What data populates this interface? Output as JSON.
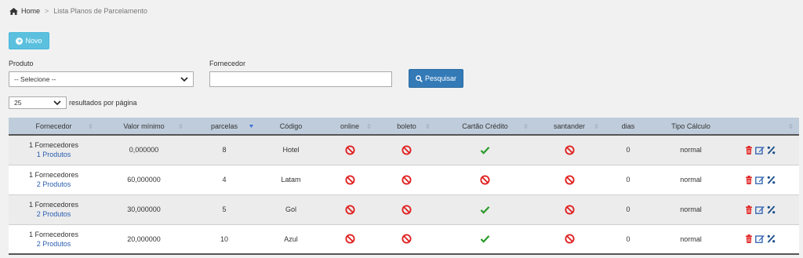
{
  "breadcrumb": {
    "home": "Home",
    "separator": ">",
    "current": "Lista Planos de Parcelamento"
  },
  "toolbar": {
    "novo_label": "Novo"
  },
  "filters": {
    "produto_label": "Produto",
    "produto_value": "-- Selecione --",
    "fornecedor_label": "Fornecedor",
    "fornecedor_value": "",
    "pesquisar_label": "Pesquisar"
  },
  "pagination": {
    "page_size": "25",
    "page_size_label": "resultados por página"
  },
  "table": {
    "columns": [
      "Fornecedor",
      "Valor mínimo",
      "parcelas",
      "Código",
      "online",
      "boleto",
      "Cartão Crédito",
      "santander",
      "dias",
      "Tipo Cálculo",
      ""
    ],
    "rows": [
      {
        "fornecedores": "1 Fornecedores",
        "produtos": "1 Produtos",
        "valor_minimo": "0,000000",
        "parcelas": "8",
        "codigo": "Hotel",
        "online": "no",
        "boleto": "no",
        "cartao_credito": "yes",
        "santander": "no",
        "dias": "0",
        "tipo_calculo": "normal"
      },
      {
        "fornecedores": "1 Fornecedores",
        "produtos": "2 Produtos",
        "valor_minimo": "60,000000",
        "parcelas": "4",
        "codigo": "Latam",
        "online": "no",
        "boleto": "no",
        "cartao_credito": "no",
        "santander": "no",
        "dias": "0",
        "tipo_calculo": "normal"
      },
      {
        "fornecedores": "1 Fornecedores",
        "produtos": "2 Produtos",
        "valor_minimo": "30,000000",
        "parcelas": "5",
        "codigo": "Gol",
        "online": "no",
        "boleto": "no",
        "cartao_credito": "yes",
        "santander": "no",
        "dias": "0",
        "tipo_calculo": "normal"
      },
      {
        "fornecedores": "1 Fornecedores",
        "produtos": "2 Produtos",
        "valor_minimo": "20,000000",
        "parcelas": "10",
        "codigo": "Azul",
        "online": "no",
        "boleto": "no",
        "cartao_credito": "yes",
        "santander": "no",
        "dias": "0",
        "tipo_calculo": "normal"
      }
    ]
  },
  "colors": {
    "accent_info": "#5bc0de",
    "accent_primary": "#337ab7",
    "no_icon": "#e02020",
    "yes_icon": "#2a9a2a",
    "delete_icon": "#e02020",
    "edit_icon": "#2a5db0",
    "percent_icon": "#1a4f8a",
    "header_bg": "#bfccdb"
  },
  "icons": {
    "home": "home-icon",
    "novo": "plus-circle-icon",
    "search": "search-icon",
    "dropdown": "chevron-down-icon",
    "no": "ban-icon",
    "yes": "check-icon",
    "delete": "trash-icon",
    "edit": "edit-icon",
    "percent": "percent-icon",
    "sort": "sort-icon"
  }
}
